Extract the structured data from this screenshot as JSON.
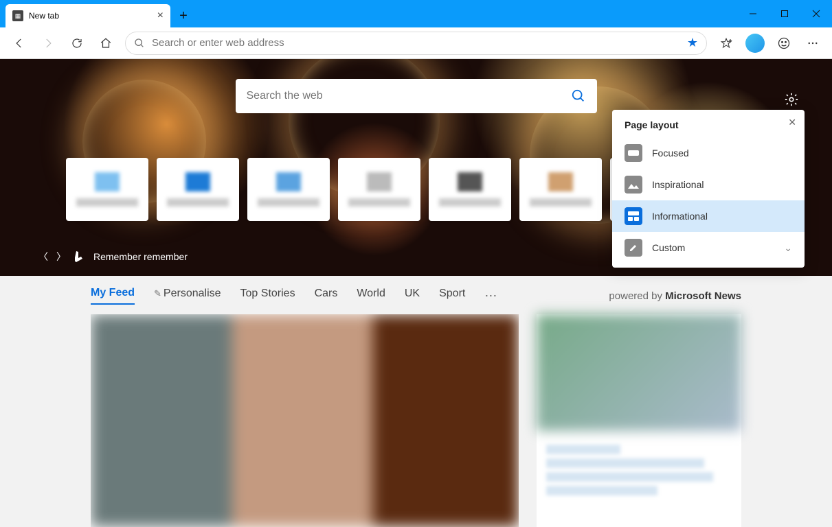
{
  "window": {
    "tab_title": "New tab"
  },
  "address_bar": {
    "placeholder": "Search or enter web address"
  },
  "hero": {
    "search_placeholder": "Search the web",
    "caption": "Remember remember"
  },
  "layout_popup": {
    "title": "Page layout",
    "options": [
      "Focused",
      "Inspirational",
      "Informational",
      "Custom"
    ],
    "selected": "Informational"
  },
  "feed": {
    "tabs": [
      "My Feed",
      "Personalise",
      "Top Stories",
      "Cars",
      "World",
      "UK",
      "Sport"
    ],
    "active": "My Feed",
    "powered_prefix": "powered by ",
    "powered_brand": "Microsoft News"
  }
}
